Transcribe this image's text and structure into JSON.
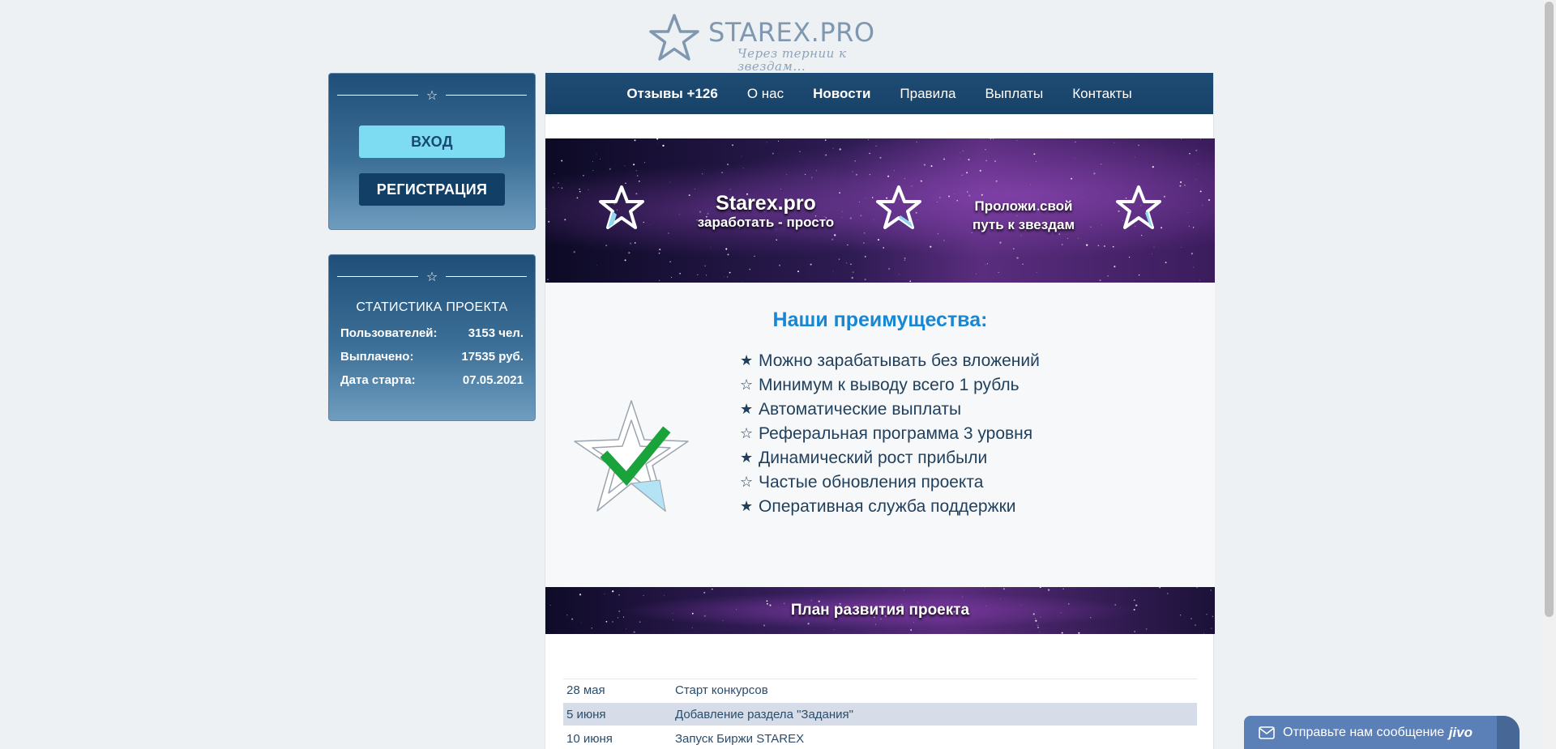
{
  "logo": {
    "title": "STAREX.PRO",
    "subtitle": "Через тернии к звездам..."
  },
  "sidebar": {
    "login_label": "ВХОД",
    "register_label": "РЕГИСТРАЦИЯ",
    "stats_title": "СТАТИСТИКА ПРОЕКТА",
    "stats": [
      {
        "label": "Пользователей:",
        "value": "3153 чел."
      },
      {
        "label": "Выплачено:",
        "value": "17535 руб."
      },
      {
        "label": "Дата старта:",
        "value": "07.05.2021"
      }
    ]
  },
  "nav": {
    "items": [
      {
        "label": "Отзывы +126"
      },
      {
        "label": "О нас"
      },
      {
        "label": "Новости"
      },
      {
        "label": "Правила"
      },
      {
        "label": "Выплаты"
      },
      {
        "label": "Контакты"
      }
    ]
  },
  "banner": {
    "title": "Starex.pro",
    "subtitle": "заработать - просто",
    "slogan_line1": "Проложи свой",
    "slogan_line2": "путь к звездам"
  },
  "advantages": {
    "title": "Наши преимущества:",
    "items": [
      {
        "bullet": "★",
        "text": "Можно зарабатывать без вложений"
      },
      {
        "bullet": "☆",
        "text": "Минимум к выводу всего 1 рубль"
      },
      {
        "bullet": "★",
        "text": "Автоматические выплаты"
      },
      {
        "bullet": "☆",
        "text": "Реферальная программа 3 уровня"
      },
      {
        "bullet": "★",
        "text": "Динамический рост прибыли"
      },
      {
        "bullet": "☆",
        "text": "Частые обновления проекта"
      },
      {
        "bullet": "★",
        "text": "Оперативная служба поддержки"
      }
    ]
  },
  "plan": {
    "title": "План развития проекта",
    "rows": [
      {
        "date": "28 мая",
        "text": "Старт конкурсов"
      },
      {
        "date": "5 июня",
        "text": "Добавление раздела \"Задания\""
      },
      {
        "date": "10 июня",
        "text": "Запуск Биржи STAREX"
      }
    ]
  },
  "chat": {
    "label": "Отправьте нам сообщение",
    "brand": "jivo"
  },
  "colors": {
    "accent": "#1687d4",
    "nav_bg": "#1f4c74",
    "login_button": "#7edcf2",
    "register_button": "#123f66"
  }
}
